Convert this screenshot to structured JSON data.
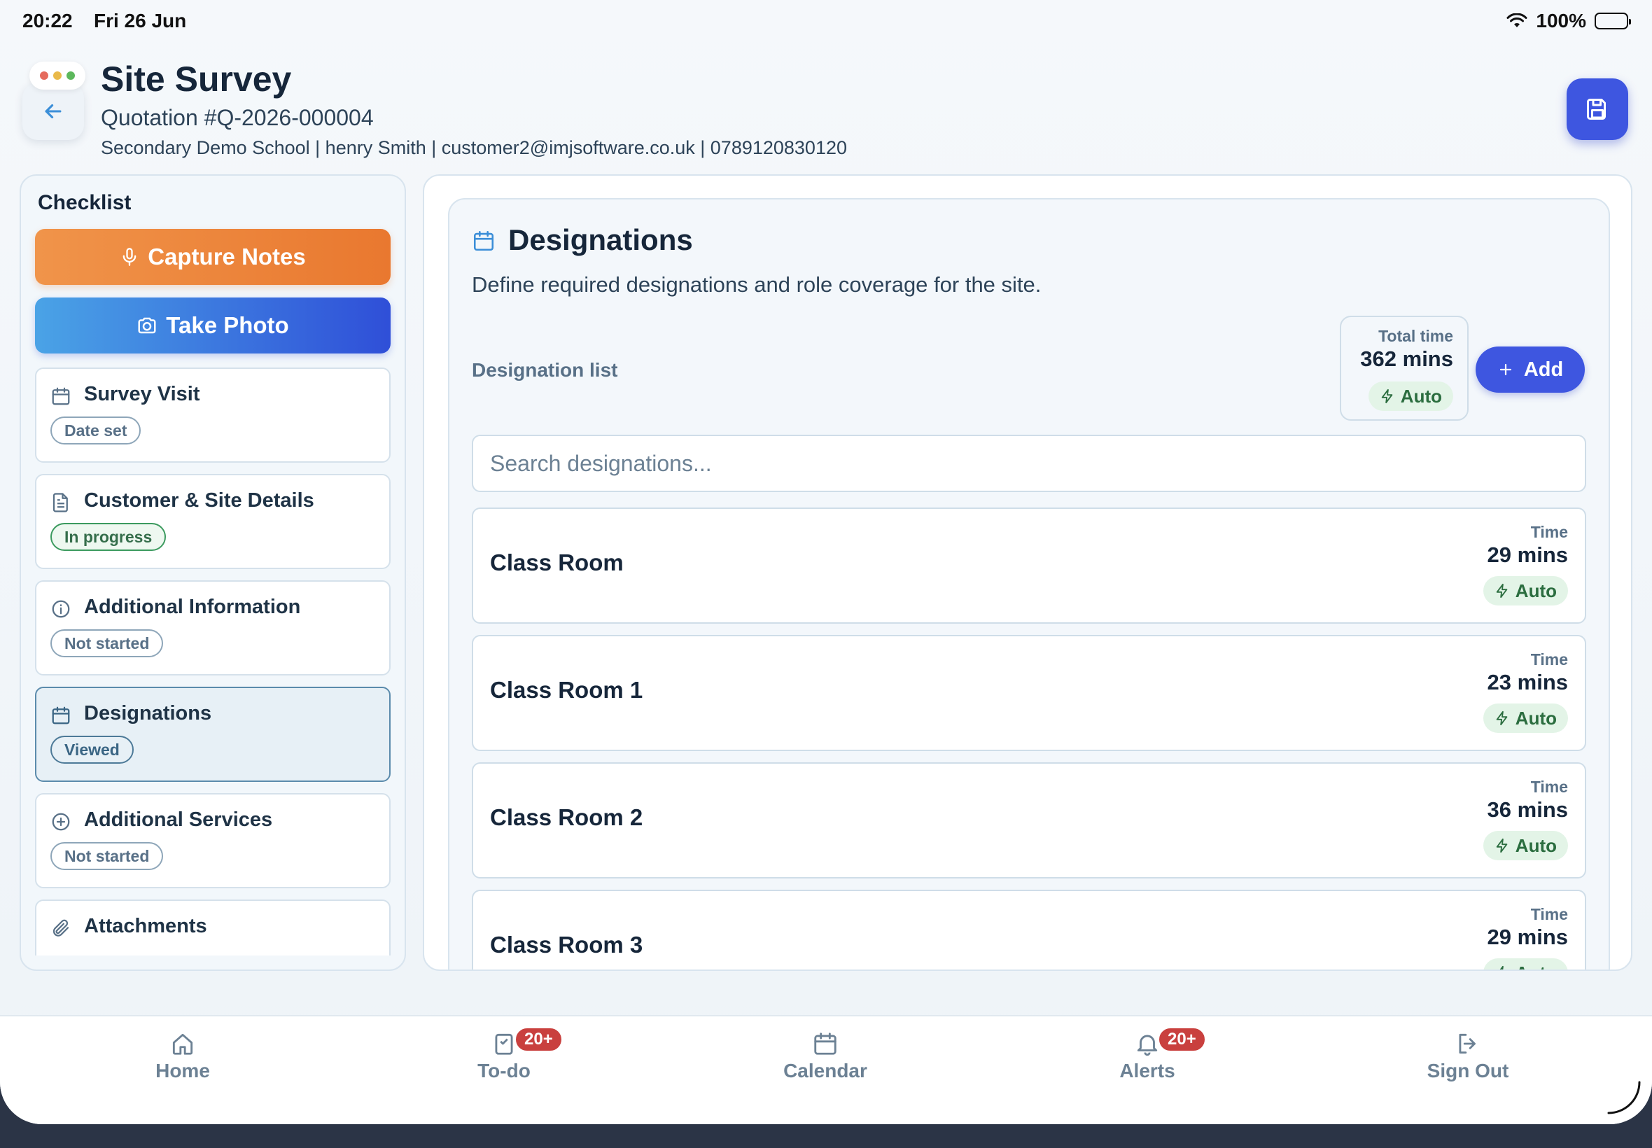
{
  "status_bar": {
    "time": "20:22",
    "date": "Fri 26 Jun",
    "battery": "100%"
  },
  "header": {
    "title": "Site Survey",
    "quotation": "Quotation #Q-2026-000004",
    "contact": "Secondary Demo School | henry Smith | customer2@imjsoftware.co.uk | 0789120830120",
    "window_dots": [
      "#e56b5d",
      "#e9b949",
      "#5cb85c"
    ],
    "back_icon": "arrow-left-icon",
    "save_icon": "save-icon"
  },
  "checklist": {
    "title": "Checklist",
    "capture_notes_label": "Capture Notes",
    "take_photo_label": "Take Photo",
    "items": [
      {
        "label": "Survey Visit",
        "status": "Date set",
        "icon": "calendar-icon"
      },
      {
        "label": "Customer & Site Details",
        "status": "In progress",
        "icon": "document-icon"
      },
      {
        "label": "Additional Information",
        "status": "Not started",
        "icon": "info-icon"
      },
      {
        "label": "Designations",
        "status": "Viewed",
        "icon": "calendar-icon"
      },
      {
        "label": "Additional Services",
        "status": "Not started",
        "icon": "plus-circle-icon"
      },
      {
        "label": "Attachments",
        "status": "",
        "icon": "paperclip-icon"
      }
    ]
  },
  "designations": {
    "title": "Designations",
    "description": "Define required designations and role coverage for the site.",
    "list_label": "Designation list",
    "total_time_label": "Total time",
    "total_time_value": "362 mins",
    "auto_label": "Auto",
    "add_label": "Add",
    "search_placeholder": "Search designations...",
    "time_label": "Time",
    "rows": [
      {
        "name": "Class Room",
        "time": "29 mins",
        "auto": "Auto"
      },
      {
        "name": "Class Room 1",
        "time": "23 mins",
        "auto": "Auto"
      },
      {
        "name": "Class Room 2",
        "time": "36 mins",
        "auto": "Auto"
      },
      {
        "name": "Class Room 3",
        "time": "29 mins",
        "auto": "Auto"
      }
    ]
  },
  "tabbar": {
    "tabs": [
      {
        "label": "Home",
        "icon": "home-icon",
        "badge": ""
      },
      {
        "label": "To-do",
        "icon": "todo-icon",
        "badge": "20+"
      },
      {
        "label": "Calendar",
        "icon": "calendar-icon",
        "badge": ""
      },
      {
        "label": "Alerts",
        "icon": "bell-icon",
        "badge": "20+"
      },
      {
        "label": "Sign Out",
        "icon": "sign-out-icon",
        "badge": ""
      }
    ]
  },
  "colors": {
    "accent": "#3e56e0",
    "notes_orange": "#e9782f",
    "photo_blue": "#2f4fd8",
    "badge_red": "#c9403e",
    "auto_green": "#2b6d3f"
  }
}
